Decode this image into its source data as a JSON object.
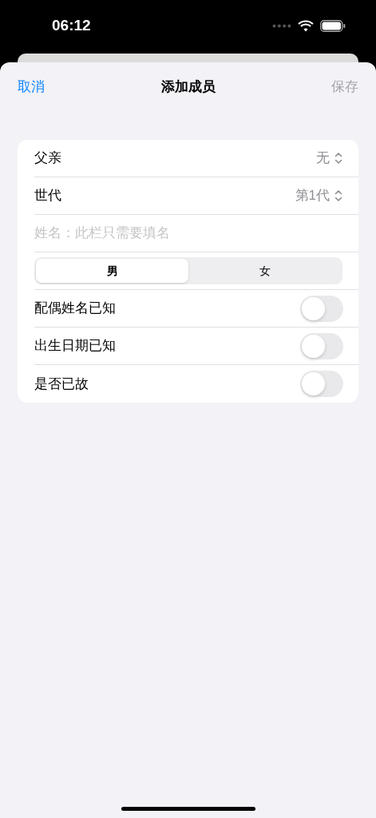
{
  "status_bar": {
    "time": "06:12"
  },
  "nav": {
    "cancel": "取消",
    "title": "添加成员",
    "save": {
      "label": "保存",
      "disabled": true
    }
  },
  "form": [
    {
      "kind": "picker",
      "label": "父亲",
      "value": "无"
    },
    {
      "kind": "picker",
      "label": "世代",
      "value": "第1代"
    },
    {
      "kind": "text",
      "placeholder": "姓名：此栏只需要填名"
    },
    {
      "kind": "segmented",
      "options": [
        {
          "label": "男",
          "selected": true
        },
        {
          "label": "女",
          "selected": false
        }
      ]
    },
    {
      "kind": "toggle",
      "label": "配偶姓名已知",
      "on": false
    },
    {
      "kind": "toggle",
      "label": "出生日期已知",
      "on": false
    },
    {
      "kind": "toggle",
      "label": "是否已故",
      "on": false
    }
  ]
}
